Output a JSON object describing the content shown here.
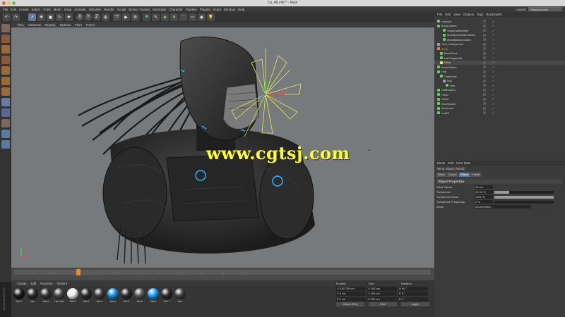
{
  "window": {
    "title": "Ca_48.c4d * - Main"
  },
  "menubar": {
    "items": [
      "File",
      "Edit",
      "Create",
      "Select",
      "Tools",
      "Mesh",
      "Snap",
      "Animate",
      "Simulate",
      "Render",
      "Sculpt",
      "Motion Tracker",
      "MoGraph",
      "Character",
      "Pipeline",
      "Plugins",
      "Script",
      "Window",
      "Help"
    ],
    "layout_label": "Layout:",
    "layout_value": "Startup (User)"
  },
  "toolbar": {
    "axes": [
      "X",
      "Y",
      "Z"
    ]
  },
  "viewport": {
    "menu": [
      "View",
      "Cameras",
      "Display",
      "Options",
      "Filter",
      "Panel"
    ],
    "watermark": "www.cgtsj.com"
  },
  "objects": {
    "menu": [
      "File",
      "Edit",
      "View",
      "Objects",
      "Tags",
      "Bookmarks"
    ],
    "items": [
      {
        "name": "Camera",
        "indent": 0,
        "color": "#9aa"
      },
      {
        "name": "BodyCables",
        "indent": 0,
        "color": "#6c6"
      },
      {
        "name": "SmallCablesSide",
        "indent": 2,
        "color": "#6c6"
      },
      {
        "name": "MetalDownsideCables",
        "indent": 2,
        "color": "#6c6"
      },
      {
        "name": "MetalMiddleCables",
        "indent": 2,
        "color": "#6c6"
      },
      {
        "name": "Grid_Honeycomb",
        "indent": 0,
        "color": "#9aa"
      },
      {
        "name": "Body",
        "indent": 0,
        "color": "#d84"
      },
      {
        "name": "BackPiece",
        "indent": 1,
        "color": "#6c6"
      },
      {
        "name": "HairSingleEdit",
        "indent": 1,
        "color": "#6c6"
      },
      {
        "name": "Wind",
        "indent": 1,
        "color": "#ee5"
      },
      {
        "name": "NeckCables",
        "indent": 0,
        "color": "#6c6"
      },
      {
        "name": "Hair",
        "indent": 0,
        "color": "#6c6"
      },
      {
        "name": "CableHair",
        "indent": 1,
        "color": "#6c6"
      },
      {
        "name": "Null",
        "indent": 2,
        "color": "#9aa"
      },
      {
        "name": "Hair",
        "indent": 3,
        "color": "#6c6"
      },
      {
        "name": "CablesArm",
        "indent": 0,
        "color": "#6c6"
      },
      {
        "name": "Head",
        "indent": 0,
        "color": "#6c6"
      },
      {
        "name": "Chest",
        "indent": 0,
        "color": "#6c6"
      },
      {
        "name": "ArmMuscle",
        "indent": 0,
        "color": "#6c6"
      },
      {
        "name": "Abdomen",
        "indent": 0,
        "color": "#6c6"
      },
      {
        "name": "LowPt",
        "indent": 0,
        "color": "#6c6"
      }
    ]
  },
  "attributes": {
    "menu": [
      "Mode",
      "Edit",
      "User Data"
    ],
    "title": "Wind Object [Wind]",
    "tabs": [
      "Basic",
      "Coord.",
      "Object",
      "Falloff"
    ],
    "active_tab": "Object",
    "section": "Object Properties",
    "rows": [
      {
        "label": "Wind Speed",
        "value": "20 cm",
        "fill": 0
      },
      {
        "label": "Turbulence",
        "value": "25.00 %",
        "fill": 0.25
      },
      {
        "label": "Turbulence Scale",
        "value": "1000 %",
        "fill": 1.0
      },
      {
        "label": "Turbulence Frequency",
        "value": "0 %",
        "fill": 0.0
      },
      {
        "label": "Mode",
        "value": "Acceleration",
        "fill": 0
      }
    ]
  },
  "materials": {
    "menu": [
      "Create",
      "Edit",
      "Function",
      "Texture"
    ],
    "items": [
      {
        "label": "Mat.1",
        "color": "#1a1a1a"
      },
      {
        "label": "Mat.",
        "color": "#2a2a2a"
      },
      {
        "label": "Mat.2",
        "color": "#333"
      },
      {
        "label": "Hair Mat",
        "color": "#444"
      },
      {
        "label": "Mat.3",
        "color": "#eeeeee"
      },
      {
        "label": "Mat.2",
        "color": "#2c2c2c"
      },
      {
        "label": "Mat.1",
        "color": "#3a3a3a"
      },
      {
        "label": "Mat.4",
        "color": "#1a8fe0"
      },
      {
        "label": "Mat.2",
        "color": "#2a2a2a"
      },
      {
        "label": "Mat.5",
        "color": "#555"
      },
      {
        "label": "Mat.6",
        "color": "#1aa0ff"
      },
      {
        "label": "Mat.7",
        "color": "#2a2a2a"
      },
      {
        "label": "Mat.",
        "color": "#404040"
      }
    ]
  },
  "coordinates": {
    "headers": [
      "Position",
      "Size",
      "Rotation"
    ],
    "rows": [
      [
        "X 519.798 cm",
        "X 200 cm",
        "H 90 °"
      ],
      [
        "Y 0 cm",
        "Y 200 cm",
        "P 0 °"
      ],
      [
        "Z 0 cm",
        "Z 200 cm",
        "B 0 °"
      ]
    ],
    "mode_left": "Object (Rel)",
    "mode_right": "Size",
    "apply_label": "Apply"
  },
  "branding": {
    "side_text": "MAXON CINEMA 4D"
  }
}
